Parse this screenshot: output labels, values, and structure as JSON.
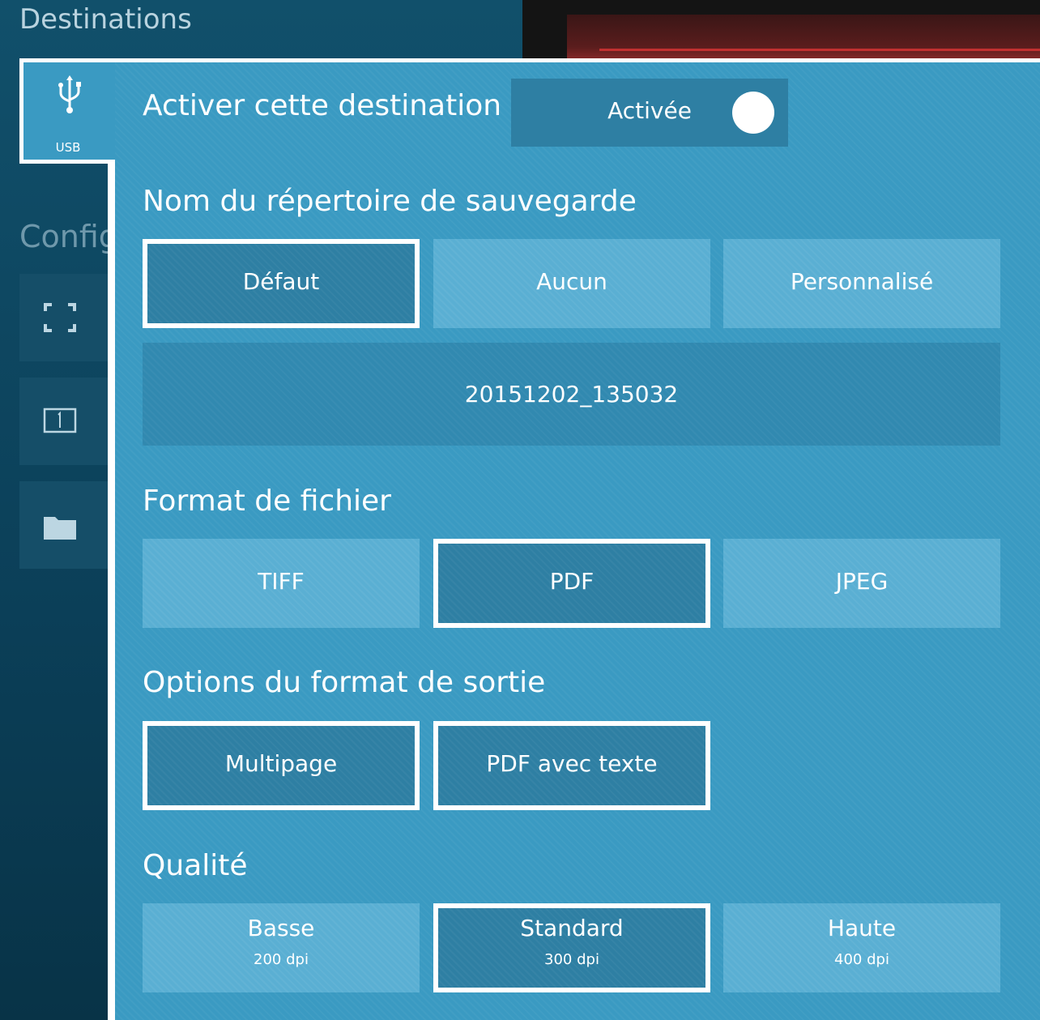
{
  "background": {
    "title": "Destinations",
    "config_label": "Config",
    "tiles": [
      {
        "icon": "fullscreen-icon"
      },
      {
        "icon": "single-page-icon"
      },
      {
        "icon": "folder-icon"
      }
    ]
  },
  "usb_tab": {
    "icon": "usb-icon",
    "label": "USB"
  },
  "enable": {
    "heading": "Activer cette destination",
    "toggle_label": "Activée",
    "toggle_on": true
  },
  "directory": {
    "heading": "Nom du répertoire de sauvegarde",
    "options": [
      "Défaut",
      "Aucun",
      "Personnalisé"
    ],
    "selected": "Défaut",
    "value": "20151202_135032"
  },
  "file_format": {
    "heading": "Format de fichier",
    "options": [
      "TIFF",
      "PDF",
      "JPEG"
    ],
    "selected": "PDF"
  },
  "output_options": {
    "heading": "Options du format de sortie",
    "options": [
      "Multipage",
      "PDF avec texte"
    ],
    "selected": [
      "Multipage",
      "PDF avec texte"
    ]
  },
  "quality": {
    "heading": "Qualité",
    "options": [
      {
        "label": "Basse",
        "dpi": "200 dpi"
      },
      {
        "label": "Standard",
        "dpi": "300 dpi"
      },
      {
        "label": "Haute",
        "dpi": "400 dpi"
      }
    ],
    "selected": "Standard"
  },
  "colors": {
    "panel": "#3a9ac2",
    "option": "#5aafd3",
    "selected_option": "#2e7fa3",
    "background": "#0b3f58"
  }
}
